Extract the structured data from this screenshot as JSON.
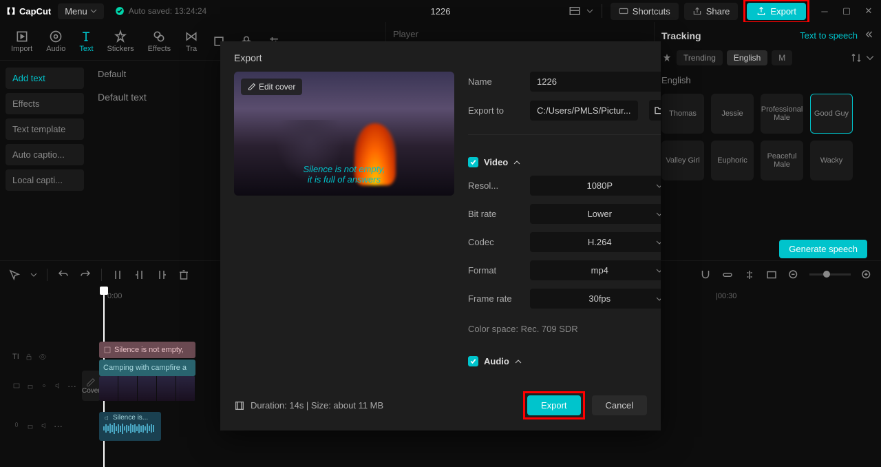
{
  "titlebar": {
    "app_name": "CapCut",
    "menu_label": "Menu",
    "autosave": "Auto saved: 13:24:24",
    "project_title": "1226",
    "shortcuts": "Shortcuts",
    "share": "Share",
    "export": "Export"
  },
  "tabs": {
    "import": "Import",
    "audio": "Audio",
    "text": "Text",
    "stickers": "Stickers",
    "effects": "Effects",
    "transitions": "Tra"
  },
  "player_label": "Player",
  "sidebar": {
    "add_text": "Add text",
    "effects": "Effects",
    "text_template": "Text template",
    "auto_captions": "Auto captio...",
    "local_captions": "Local capti..."
  },
  "default_area": {
    "label": "Default",
    "text": "Default text"
  },
  "right_panel": {
    "title": "Tracking",
    "tts": "Text to speech",
    "trending": "Trending",
    "english_chip": "English",
    "m_chip": "M",
    "lang_label": "English",
    "voices": {
      "thomas": "Thomas",
      "jessie": "Jessie",
      "prof_male": "Professional Male",
      "good_guy": "Good Guy",
      "valley_girl": "Valley Girl",
      "euphoric": "Euphoric",
      "peaceful_male": "Peaceful Male",
      "wacky": "Wacky"
    },
    "generate": "Generate speech"
  },
  "export_dialog": {
    "title": "Export",
    "edit_cover": "Edit cover",
    "cover_text_line1": "Silence is not empty,",
    "cover_text_line2": "it is full of answers",
    "name_label": "Name",
    "name_value": "1226",
    "export_to_label": "Export to",
    "export_to_value": "C:/Users/PMLS/Pictur...",
    "video_section": "Video",
    "resolution_label": "Resol...",
    "resolution_value": "1080P",
    "bitrate_label": "Bit rate",
    "bitrate_value": "Lower",
    "codec_label": "Codec",
    "codec_value": "H.264",
    "format_label": "Format",
    "format_value": "mp4",
    "framerate_label": "Frame rate",
    "framerate_value": "30fps",
    "color_space": "Color space: Rec. 709 SDR",
    "audio_section": "Audio",
    "duration": "Duration: 14s | Size: about 11 MB",
    "export_btn": "Export",
    "cancel_btn": "Cancel"
  },
  "timeline": {
    "t0": "0:00",
    "t1": "|00:30",
    "cover": "Cover",
    "clip_text": "Silence is not empty,",
    "clip_video": "Camping with campfire a",
    "clip_audio": "Silence is..."
  }
}
